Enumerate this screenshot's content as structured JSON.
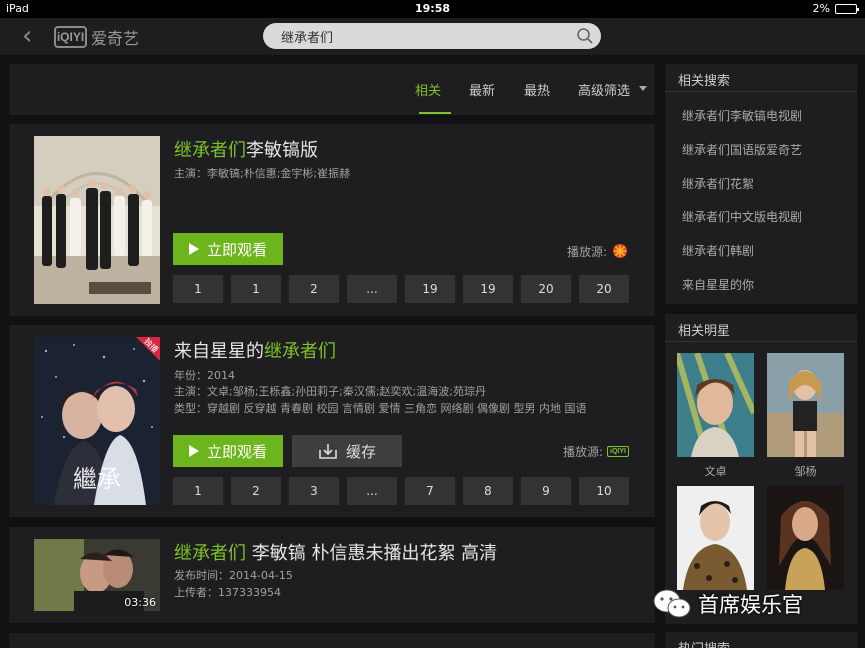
{
  "status_bar": {
    "device": "iPad",
    "time": "19:58",
    "battery": "2%"
  },
  "header": {
    "logo_mark": "iQIYI",
    "logo_text": "爱奇艺",
    "search_query": "继承者们"
  },
  "tabs": [
    {
      "label": "相关",
      "active": true
    },
    {
      "label": "最新",
      "active": false
    },
    {
      "label": "最热",
      "active": false
    },
    {
      "label": "高级筛选",
      "active": false
    }
  ],
  "results": [
    {
      "title_highlight": "继承者们",
      "title_rest": "李敏镐版",
      "cast": "主演：李敏镐;朴信惠;金宇彬;崔振赫",
      "watch_label": "立即观看",
      "source_label": "播放源:",
      "episodes": [
        "1",
        "1",
        "2",
        "...",
        "19",
        "19",
        "20",
        "20"
      ]
    },
    {
      "title_prefix": "来自星星的",
      "title_highlight": "继承者们",
      "year": "年份：2014",
      "cast": "主演：文卓;邹杨;王栎鑫;孙田莉子;秦汉儒;赵奕欢;温海波;苑琮丹",
      "genres": "类型：穿越剧 反穿越 青春剧 校园 言情剧 爱情 三角恋 网络剧 偶像剧 型男 内地 国语",
      "watch_label": "立即观看",
      "cache_label": "缓存",
      "source_label": "播放源:",
      "source_logo": "iQIYI",
      "badge": "独播",
      "episodes": [
        "1",
        "2",
        "3",
        "...",
        "7",
        "8",
        "9",
        "10"
      ]
    },
    {
      "title_highlight": "继承者们",
      "title_rest": " 李敏镐 朴信惠未播出花絮 高清",
      "publish_time": "发布时间：2014-04-15",
      "uploader": "上传者：137333954",
      "duration": "03:36"
    }
  ],
  "related_search": {
    "title": "相关搜索",
    "items": [
      "继承者们李敏镐电视剧",
      "继承者们国语版爱奇艺",
      "继承者们花絮",
      "继承者们中文版电视剧",
      "继承者们韩剧",
      "来自星星的你"
    ]
  },
  "related_stars": {
    "title": "相关明星",
    "stars": [
      {
        "name": "文卓"
      },
      {
        "name": "邹杨"
      },
      {
        "name": ""
      },
      {
        "name": ""
      }
    ]
  },
  "hot_search": {
    "title": "热门搜索"
  },
  "watermark": "首席娱乐官",
  "colors": {
    "accent": "#7ec12a",
    "button_green": "#6cb51c",
    "panel": "#1e1e20",
    "background": "#111113"
  }
}
